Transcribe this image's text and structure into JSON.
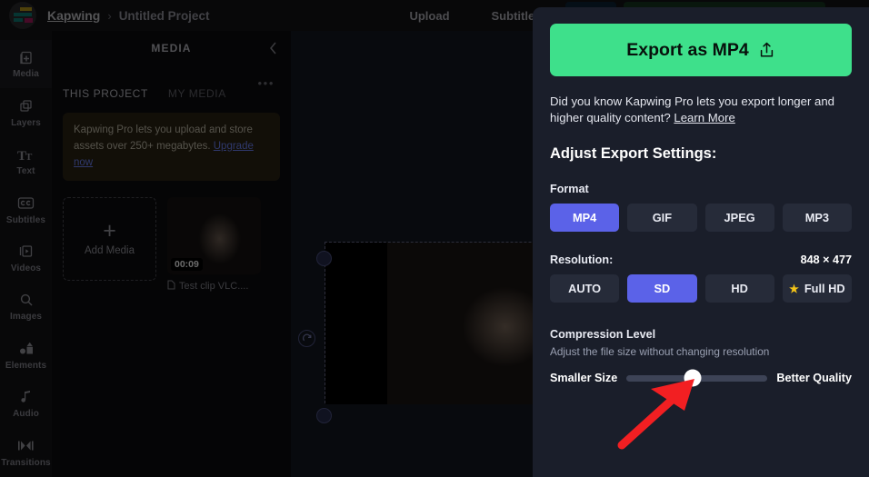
{
  "header": {
    "brand": "Kapwing",
    "separator": "›",
    "project_title": "Untitled Project",
    "nav": [
      {
        "label": "Upload"
      },
      {
        "label": "Subtitles"
      }
    ]
  },
  "sidebar": {
    "items": [
      {
        "label": "Media",
        "icon": "media-add-icon",
        "active": true
      },
      {
        "label": "Layers",
        "icon": "layers-icon",
        "active": false
      },
      {
        "label": "Text",
        "icon": "text-icon",
        "active": false
      },
      {
        "label": "Subtitles",
        "icon": "closed-caption-icon",
        "active": false
      },
      {
        "label": "Videos",
        "icon": "video-icon",
        "active": false
      },
      {
        "label": "Images",
        "icon": "search-icon",
        "active": false
      },
      {
        "label": "Elements",
        "icon": "shapes-icon",
        "active": false
      },
      {
        "label": "Audio",
        "icon": "music-note-icon",
        "active": false
      },
      {
        "label": "Transitions",
        "icon": "transitions-icon",
        "active": false
      }
    ]
  },
  "media_panel": {
    "title": "MEDIA",
    "collapse_icon": "chevron-left-icon",
    "overflow_icon": "more-options-icon",
    "overflow_label": "•••",
    "tabs": [
      {
        "label": "THIS PROJECT",
        "active": true
      },
      {
        "label": "MY MEDIA",
        "active": false
      }
    ],
    "promo": {
      "text": "Kapwing Pro lets you upload and store assets over 250+ megabytes. ",
      "link": "Upgrade now"
    },
    "add_media": {
      "plus": "+",
      "label": "Add Media"
    },
    "assets": [
      {
        "name": "Test clip VLC....",
        "duration": "00:09",
        "file_icon": "file-icon"
      }
    ]
  },
  "canvas": {
    "rotate_icon": "rotate-handle-icon"
  },
  "export_panel": {
    "export_button": {
      "label": "Export as MP4",
      "icon": "share-upload-icon"
    },
    "pro_note": {
      "text": "Did you know Kapwing Pro lets you export longer and higher quality content? ",
      "link": "Learn More"
    },
    "settings_heading": "Adjust Export Settings:",
    "format": {
      "label": "Format",
      "options": [
        {
          "label": "MP4",
          "selected": true
        },
        {
          "label": "GIF",
          "selected": false
        },
        {
          "label": "JPEG",
          "selected": false
        },
        {
          "label": "MP3",
          "selected": false
        }
      ]
    },
    "resolution": {
      "label": "Resolution:",
      "value": "848 × 477",
      "options": [
        {
          "label": "AUTO",
          "selected": false,
          "star": false
        },
        {
          "label": "SD",
          "selected": true,
          "star": false
        },
        {
          "label": "HD",
          "selected": false,
          "star": false
        },
        {
          "label": "Full HD",
          "selected": false,
          "star": true
        }
      ]
    },
    "compression": {
      "title": "Compression Level",
      "subtitle": "Adjust the file size without changing resolution",
      "min_label": "Smaller Size",
      "max_label": "Better Quality",
      "value_percent": 47
    }
  },
  "annotation": {
    "arrow_color": "#f21f22"
  },
  "colors": {
    "accent_green": "#3ee08b",
    "accent_indigo": "#5b62e8",
    "panel_bg": "#1a1e2a",
    "star_gold": "#f5c518",
    "link_blue": "#6f86ff"
  }
}
